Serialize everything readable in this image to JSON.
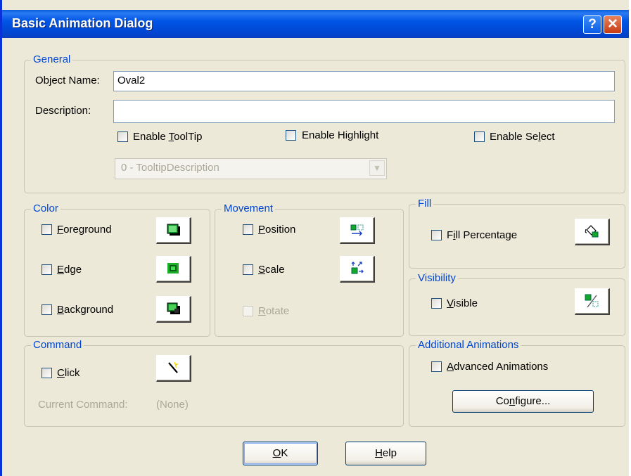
{
  "window": {
    "title": "Basic Animation Dialog",
    "help_glyph": "?",
    "close_glyph": "✕"
  },
  "general": {
    "legend": "General",
    "object_name_label": "Object Name:",
    "object_name_value": "Oval2",
    "description_label": "Description:",
    "description_value": "",
    "enable_tooltip": {
      "pre": "Enable ",
      "key": "T",
      "post": "oolTip"
    },
    "enable_highlight": {
      "pre": "Enable Hi",
      "key": "g",
      "post": "hlight"
    },
    "enable_select": {
      "pre": "Enable Se",
      "key": "l",
      "post": "ect"
    },
    "tooltip_select_value": "0 - TooltipDescription"
  },
  "color": {
    "legend": "Color",
    "foreground": {
      "key": "F",
      "post": "oreground"
    },
    "edge": {
      "key": "E",
      "post": "dge"
    },
    "background": {
      "key": "B",
      "post": "ackground"
    }
  },
  "movement": {
    "legend": "Movement",
    "position": {
      "key": "P",
      "post": "osition"
    },
    "scale": {
      "key": "S",
      "post": "cale"
    },
    "rotate": {
      "key": "R",
      "post": "otate"
    }
  },
  "fill": {
    "legend": "Fill",
    "fill_percentage": {
      "pre": "F",
      "key": "i",
      "post": "ll Percentage"
    }
  },
  "visibility": {
    "legend": "Visibility",
    "visible": {
      "key": "V",
      "post": "isible"
    }
  },
  "command": {
    "legend": "Command",
    "click": {
      "key": "C",
      "post": "lick"
    },
    "current_command_label": "Current Command:",
    "current_command_value": "(None)"
  },
  "additional": {
    "legend": "Additional Animations",
    "advanced": {
      "key": "A",
      "post": "dvanced Animations"
    },
    "configure": {
      "pre": "Co",
      "key": "n",
      "post": "figure..."
    }
  },
  "buttons": {
    "ok": {
      "key": "O",
      "post": "K"
    },
    "help": {
      "key": "H",
      "post": "elp"
    }
  },
  "icons": {
    "foreground": "foreground-color-icon",
    "edge": "edge-color-icon",
    "background": "background-color-icon",
    "position": "position-icon",
    "scale": "scale-icon",
    "fill": "fill-bucket-icon",
    "visible": "visibility-icon",
    "click": "magic-wand-icon"
  }
}
